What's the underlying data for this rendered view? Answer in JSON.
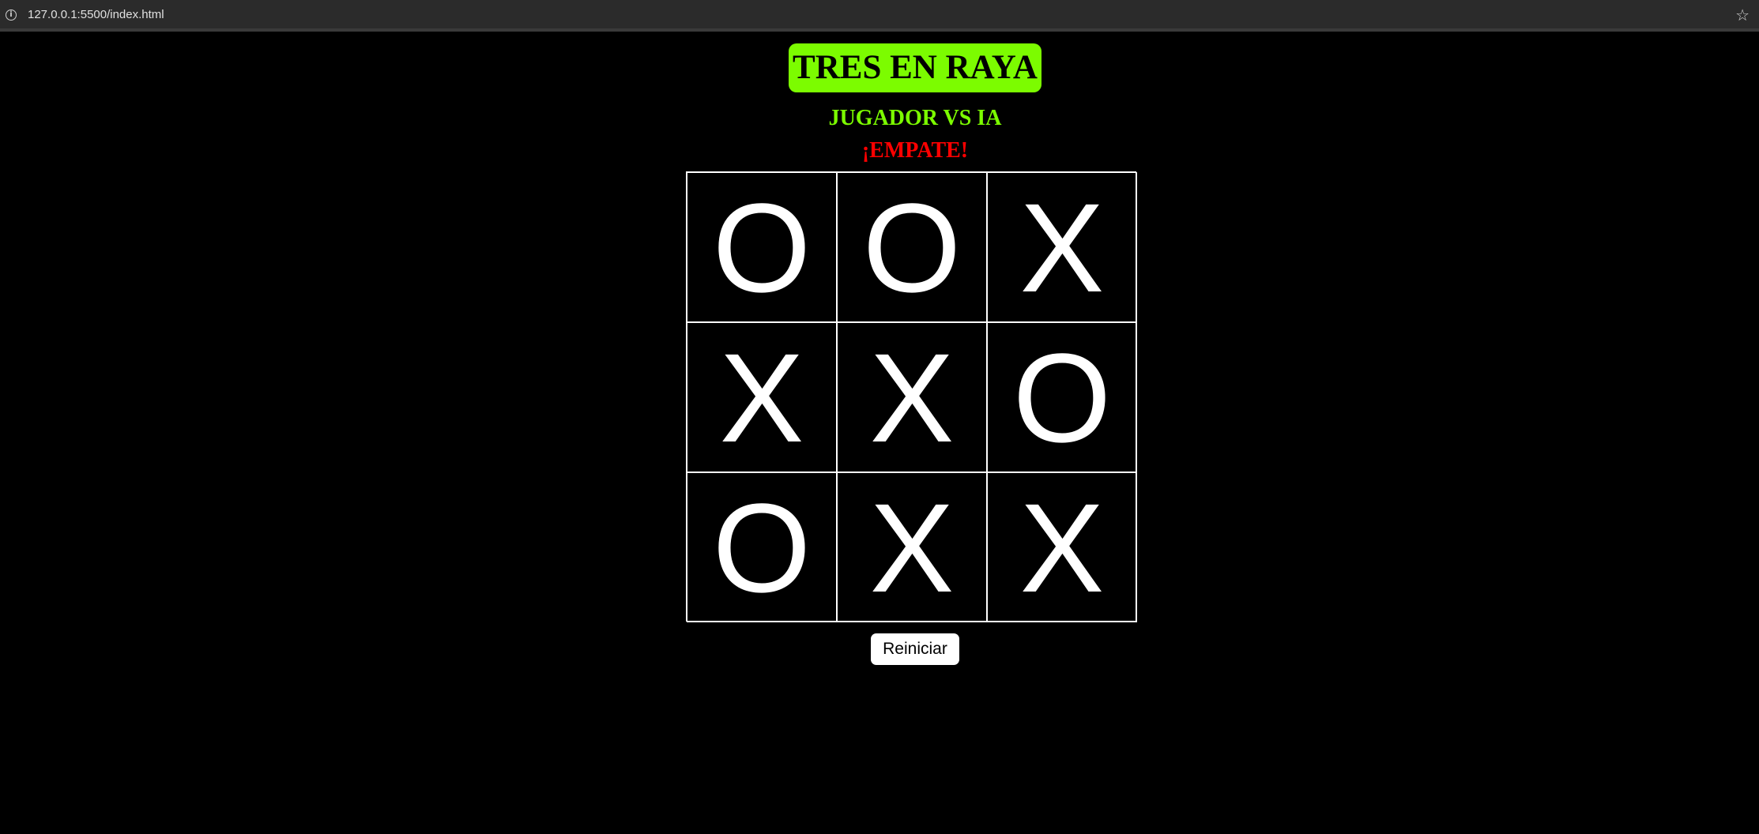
{
  "browser": {
    "url": "127.0.0.1:5500/index.html",
    "info_icon": "i",
    "star_icon": "☆"
  },
  "game": {
    "title": "TRES EN RAYA",
    "mode": "JUGADOR VS IA",
    "status": "¡EMPATE!",
    "board": [
      "O",
      "O",
      "X",
      "X",
      "X",
      "O",
      "O",
      "X",
      "X"
    ],
    "reset_label": "Reiniciar"
  },
  "colors": {
    "accent": "#7cfc00",
    "status": "#ff0000",
    "background": "#000000",
    "marks": "#ffffff"
  }
}
